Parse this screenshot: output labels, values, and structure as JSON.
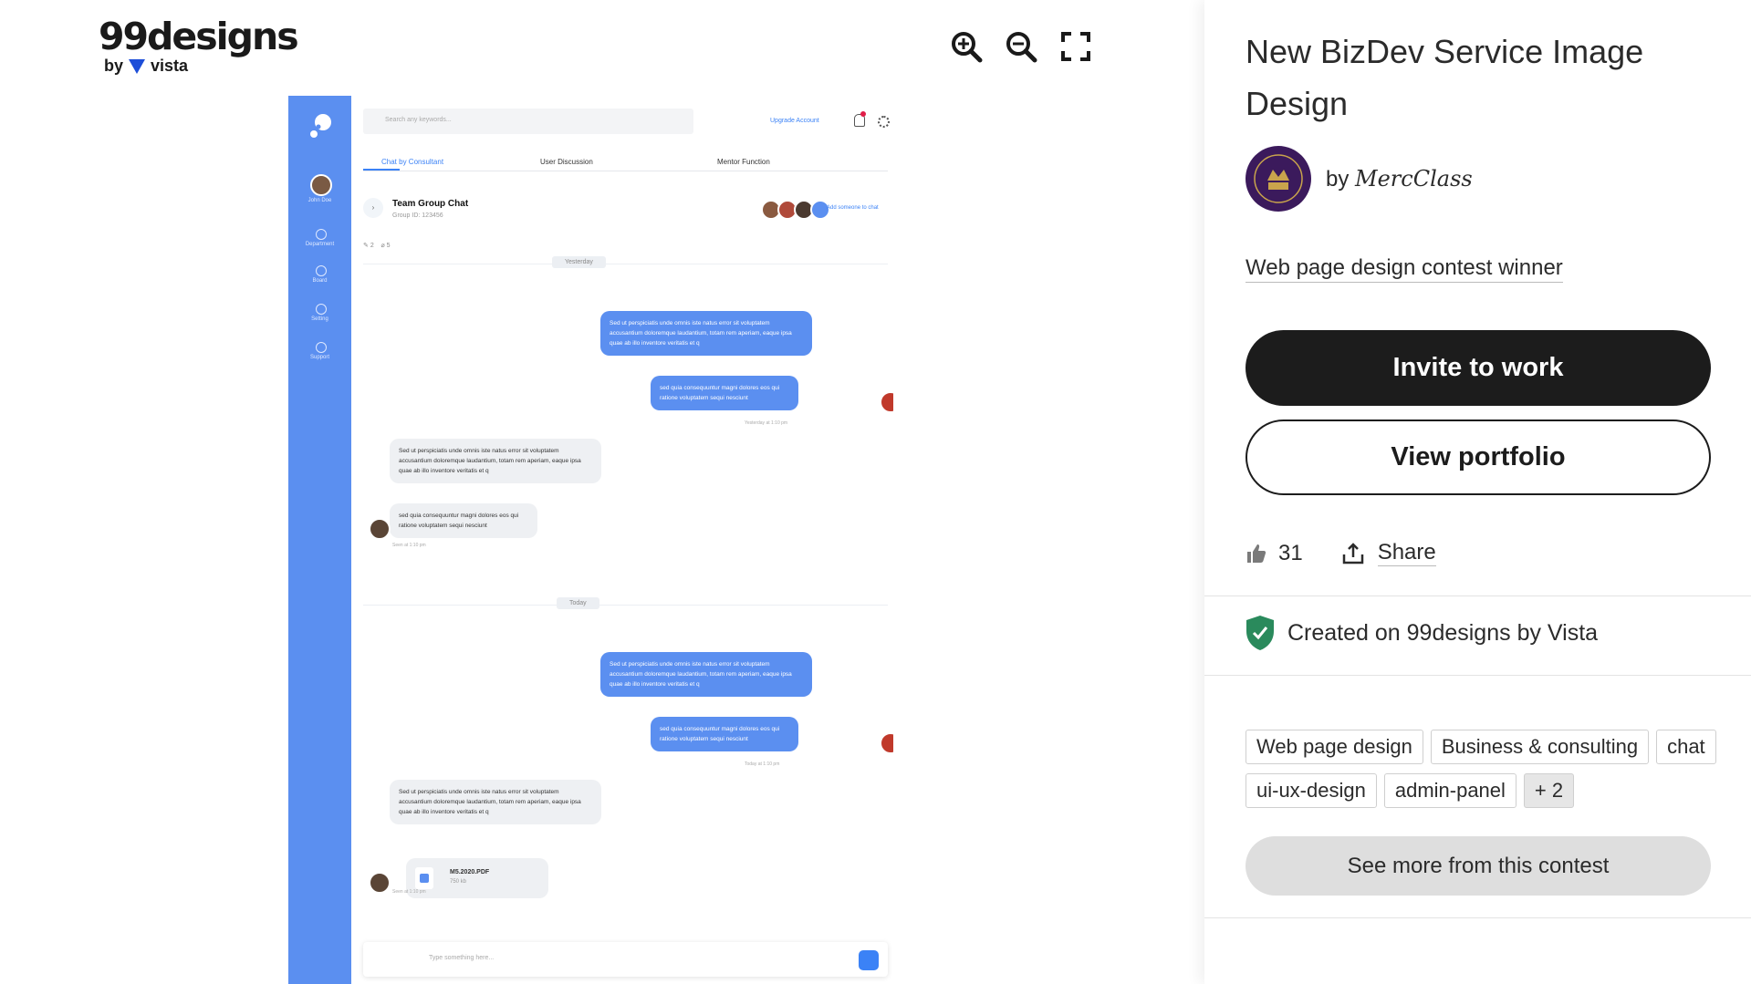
{
  "brand": {
    "name": "99designs",
    "by": "by",
    "partner": "vista"
  },
  "viewer": {
    "tools": [
      "zoom-in-icon",
      "zoom-out-icon",
      "fullscreen-icon"
    ]
  },
  "mockup": {
    "search_placeholder": "Search any keywords...",
    "upgrade": "Upgrade Account",
    "user_name": "John Doe",
    "nav": [
      "Department",
      "Board",
      "Setting",
      "Support"
    ],
    "tabs": [
      "Chat by Consultant",
      "User Discussion",
      "Mentor Function"
    ],
    "chat_title": "Team Group Chat",
    "group_id": "Group ID: 123456",
    "add_someone": "Add someone to chat",
    "pins": "2",
    "attachments": "5",
    "day1": "Yesterday",
    "day2": "Today",
    "msg_long": "Sed ut perspiciatis unde omnis iste natus error sit voluptatem accusantium doloremque laudantium, totam rem aperiam, eaque ipsa quae ab illo inventore veritatis et q",
    "msg_short": "sed quia consequuntur magni dolores eos qui ratione voluptatem sequi nesciunt",
    "time_yesterday": "Yesterday at 1:10 pm",
    "time_seen": "Seen at 1:10 pm",
    "time_today": "Today at 1:10 pm",
    "file_name": "M5.2020.PDF",
    "file_size": "750 kb",
    "input_placeholder": "Type something here..."
  },
  "panel": {
    "title": "New BizDev Service Image Design",
    "by": "by",
    "designer": "MercClass",
    "winner": "Web page design contest winner",
    "invite": "Invite to work",
    "portfolio": "View portfolio",
    "likes": "31",
    "share": "Share",
    "created": "Created on 99designs by Vista",
    "tags": [
      "Web page design",
      "Business & consulting",
      "chat",
      "ui-ux-design",
      "admin-panel"
    ],
    "tags_more": "+ 2",
    "see_more": "See more from this contest"
  },
  "colors": {
    "accent_dark": "#1c1c1c",
    "mock_blue": "#5b8ff0",
    "shield_green": "#2a8a5c"
  }
}
